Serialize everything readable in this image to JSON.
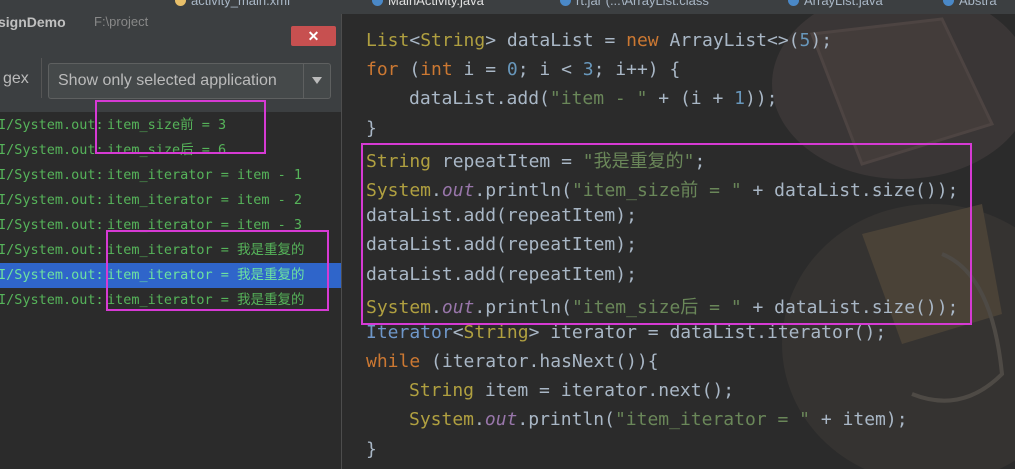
{
  "tabs": [
    {
      "label": "activity_main.xml"
    },
    {
      "label": "MainActivity.java"
    },
    {
      "label": "rt.jar (...\\ArrayList.class"
    },
    {
      "label": "ArrayList.java"
    },
    {
      "label": "Abstra"
    }
  ],
  "logcat": {
    "title": "signDemo",
    "path": "F:\\project",
    "close_glyph": "✕",
    "regex_label": "gex",
    "filter_value": "Show only selected application",
    "lines": [
      {
        "prefix": "I/System.out:",
        "message": "item_size前 = 3"
      },
      {
        "prefix": "I/System.out:",
        "message": "item_size后 = 6"
      },
      {
        "prefix": "I/System.out:",
        "message": "item_iterator = item - 1"
      },
      {
        "prefix": "I/System.out:",
        "message": "item_iterator = item - 2"
      },
      {
        "prefix": "I/System.out:",
        "message": "item_iterator = item - 3"
      },
      {
        "prefix": "I/System.out:",
        "message": "item_iterator = 我是重复的"
      },
      {
        "prefix": "I/System.out:",
        "message": "item_iterator = 我是重复的"
      },
      {
        "prefix": "I/System.out:",
        "message": "item_iterator = 我是重复的"
      }
    ]
  },
  "colors": {
    "highlight_box": "#d63ad4",
    "log_text": "#56b45a",
    "selected_row": "#2f65ca",
    "keyword": "#cc7832",
    "string": "#6a8759"
  },
  "code": {
    "l1": {
      "t1": "List",
      "t2": "<",
      "t3": "String",
      "t4": "> dataList = ",
      "t5": "new",
      "t6": " ArrayList<>(",
      "t7": "5",
      "t8": ");"
    },
    "l2": {
      "t1": "for",
      "t2": " (",
      "t3": "int",
      "t4": " i = ",
      "t5": "0",
      "t6": "; i < ",
      "t7": "3",
      "t8": "; i++) {"
    },
    "l3": {
      "t1": "dataList.add(",
      "t2": "\"item - \"",
      "t3": " + (i + ",
      "t4": "1",
      "t5": "));"
    },
    "l4": {
      "t1": "}"
    },
    "l5": {
      "t1": "String",
      "t2": " repeatItem = ",
      "t3": "\"我是重复的\"",
      "t4": ";"
    },
    "l6": {
      "t1": "System",
      "t2": ".",
      "t3": "out",
      "t4": ".println(",
      "t5": "\"item_size前 = \"",
      "t6": " + dataList.size());"
    },
    "l7": {
      "t1": "dataList.add(repeatItem);"
    },
    "l8": {
      "t1": "dataList.add(repeatItem);"
    },
    "l9": {
      "t1": "dataList.add(repeatItem);"
    },
    "l10": {
      "t1": "System",
      "t2": ".",
      "t3": "out",
      "t4": ".println(",
      "t5": "\"item_size后 = \"",
      "t6": " + dataList.size());"
    },
    "l11": {
      "t1": "Iterator",
      "t2": "<",
      "t3": "String",
      "t4": "> iterator = dataList.iterator();"
    },
    "l12": {
      "t1": "while",
      "t2": " (iterator.hasNext()){"
    },
    "l13": {
      "t1": "String",
      "t2": " item = iterator.next();"
    },
    "l14": {
      "t1": "System",
      "t2": ".",
      "t3": "out",
      "t4": ".println(",
      "t5": "\"item_iterator = \"",
      "t6": " + item);"
    },
    "l15": {
      "t1": "}"
    }
  }
}
